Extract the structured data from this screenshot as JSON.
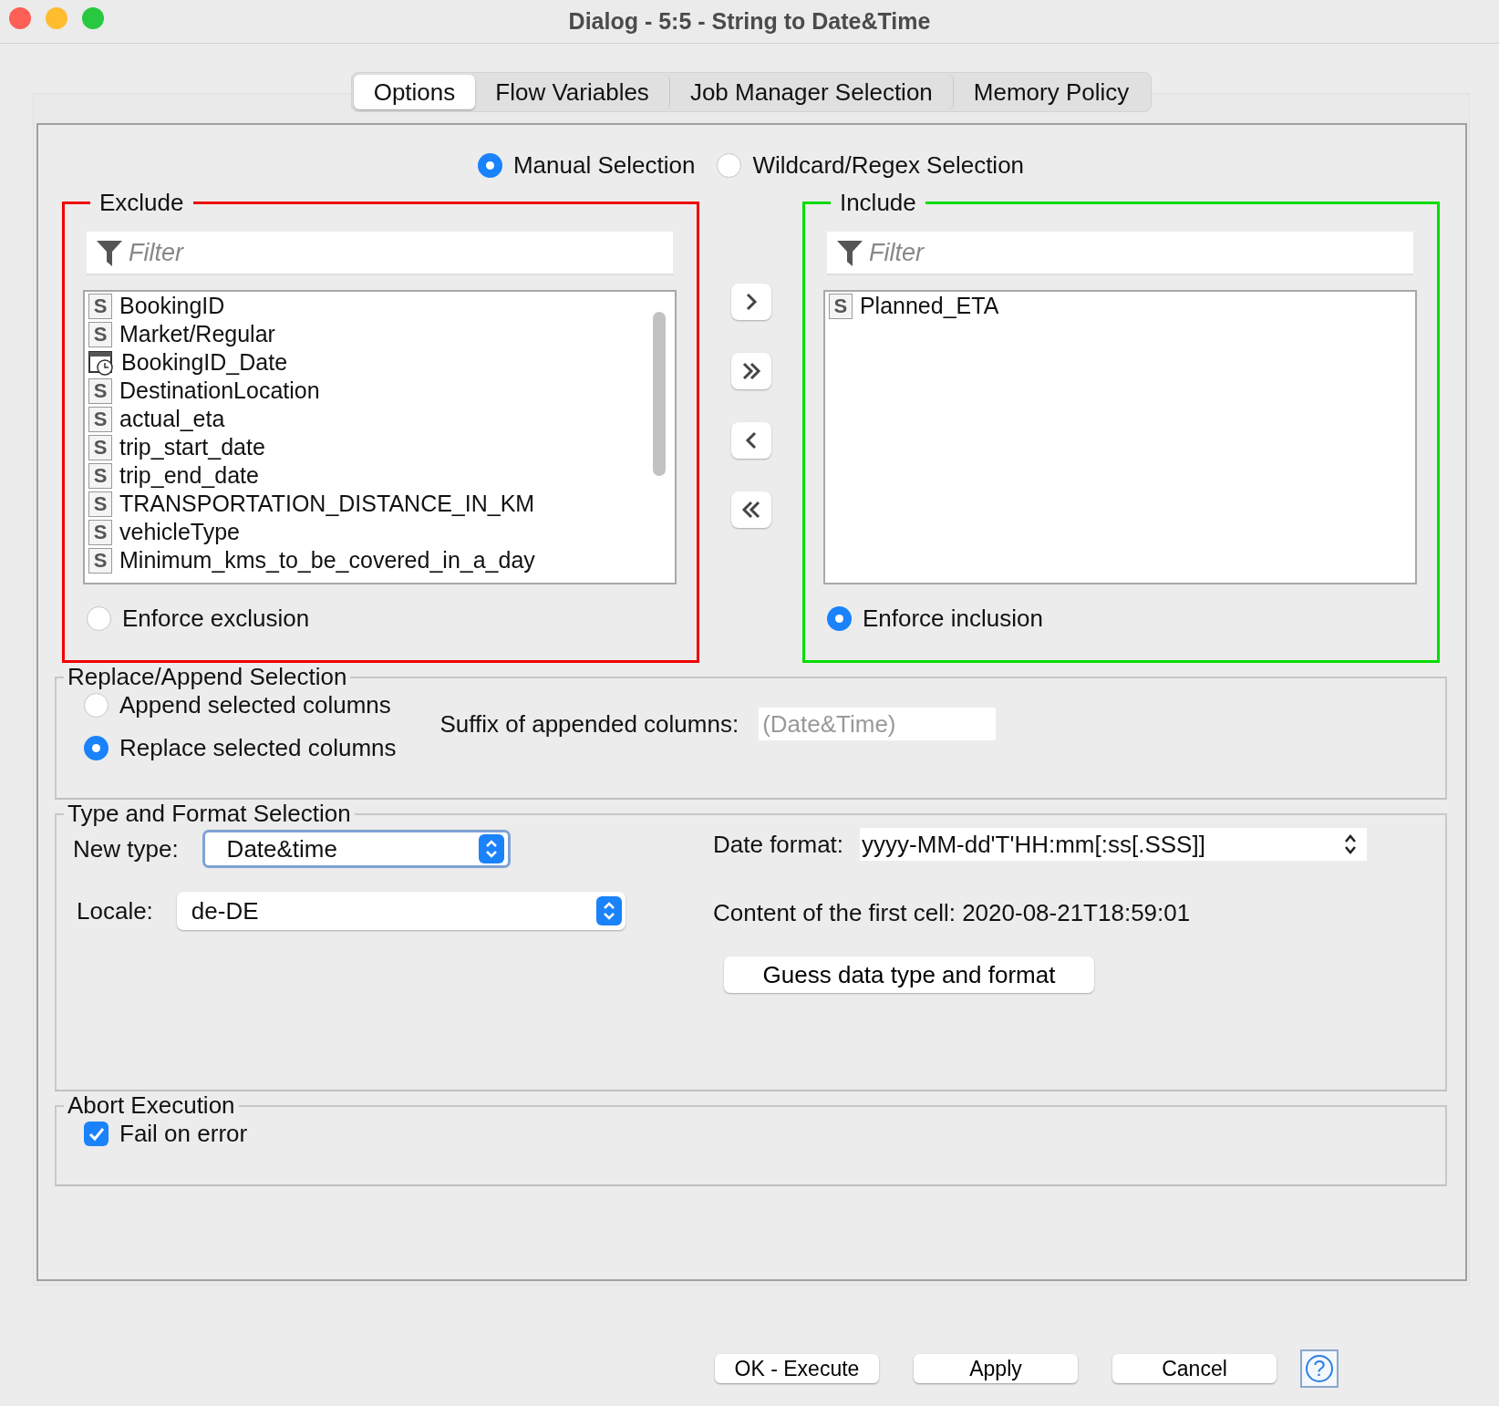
{
  "window": {
    "title": "Dialog - 5:5 - String to Date&Time"
  },
  "tabs": [
    {
      "label": "Options",
      "selected": true
    },
    {
      "label": "Flow Variables",
      "selected": false
    },
    {
      "label": "Job Manager Selection",
      "selected": false
    },
    {
      "label": "Memory Policy",
      "selected": false
    }
  ],
  "selection_mode": [
    {
      "label": "Manual Selection",
      "selected": true
    },
    {
      "label": "Wildcard/Regex Selection",
      "selected": false
    }
  ],
  "exclude": {
    "title": "Exclude",
    "filter": {
      "placeholder": "Filter"
    },
    "columns": [
      {
        "name": "BookingID",
        "kind": "string",
        "badge": "S"
      },
      {
        "name": "Market/Regular",
        "kind": "string",
        "badge": "S"
      },
      {
        "name": "BookingID_Date",
        "kind": "datetime"
      },
      {
        "name": "DestinationLocation",
        "kind": "string",
        "badge": "S"
      },
      {
        "name": "actual_eta",
        "kind": "string",
        "badge": "S"
      },
      {
        "name": "trip_start_date",
        "kind": "string",
        "badge": "S"
      },
      {
        "name": "trip_end_date",
        "kind": "string",
        "badge": "S"
      },
      {
        "name": "TRANSPORTATION_DISTANCE_IN_KM",
        "kind": "string",
        "badge": "S"
      },
      {
        "name": "vehicleType",
        "kind": "string",
        "badge": "S"
      },
      {
        "name": "Minimum_kms_to_be_covered_in_a_day",
        "kind": "string",
        "badge": "S"
      }
    ],
    "enforce": {
      "label": "Enforce exclusion",
      "selected": false
    }
  },
  "transfer_buttons": [
    {
      "kind": "add"
    },
    {
      "kind": "add_all"
    },
    {
      "kind": "remove"
    },
    {
      "kind": "remove_all"
    }
  ],
  "include": {
    "title": "Include",
    "filter": {
      "placeholder": "Filter"
    },
    "columns": [
      {
        "name": "Planned_ETA",
        "kind": "string",
        "badge": "S"
      }
    ],
    "enforce": {
      "label": "Enforce inclusion",
      "selected": true
    }
  },
  "replace_append": {
    "title": "Replace/Append Selection",
    "options": [
      {
        "label": "Append selected columns",
        "selected": false
      },
      {
        "label": "Replace selected columns",
        "selected": true
      }
    ],
    "suffix_label": "Suffix of appended columns:",
    "suffix": {
      "value": "(Date&Time)",
      "disabled": true
    }
  },
  "type_format": {
    "title": "Type and Format Selection",
    "new_type": {
      "label": "New type:",
      "value": "Date&time"
    },
    "locale": {
      "label": "Locale:",
      "value": "de-DE"
    },
    "date_format": {
      "label": "Date format:",
      "value": "yyyy-MM-dd'T'HH:mm[:ss[.SSS]]"
    },
    "first_cell": "Content of the first cell: 2020-08-21T18:59:01",
    "guess_button": "Guess data type and format"
  },
  "abort": {
    "title": "Abort Execution",
    "fail_on_error": {
      "label": "Fail on error",
      "checked": true
    }
  },
  "buttons": [
    "OK - Execute",
    "Apply",
    "Cancel"
  ],
  "help_button": "?"
}
